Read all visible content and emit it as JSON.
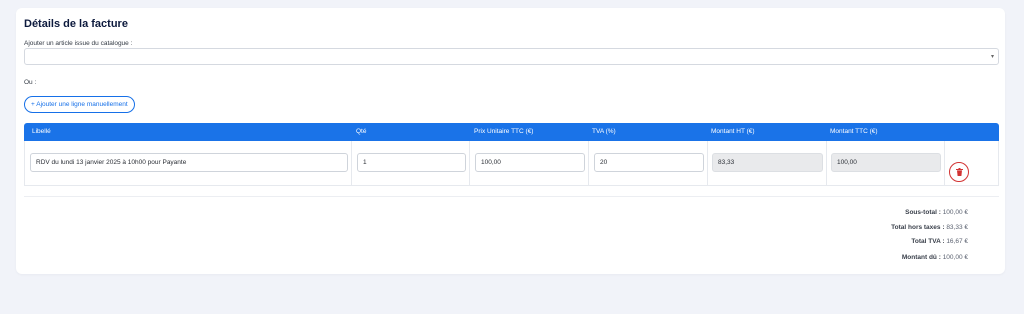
{
  "invoice": {
    "title": "Détails de la facture",
    "catalog_label": "Ajouter un article issue du catalogue :",
    "catalog_value": "",
    "or_label": "Ou :",
    "add_manual_label": "+ Ajouter une ligne manuellement"
  },
  "table": {
    "headers": {
      "libelle": "Libellé",
      "qte": "Qté",
      "prix_unitaire_ttc": "Prix Unitaire TTC (€)",
      "tva": "TVA (%)",
      "montant_ht": "Montant HT (€)",
      "montant_ttc": "Montant TTC (€)"
    },
    "rows": [
      {
        "libelle": "RDV du lundi 13 janvier 2025 à 10h00 pour Payante",
        "qte": "1",
        "prix_unitaire_ttc": "100,00",
        "tva": "20",
        "montant_ht": "83,33",
        "montant_ttc": "100,00"
      }
    ]
  },
  "totals": {
    "sous_total_label": "Sous-total :",
    "sous_total_value": "100,00 €",
    "total_ht_label": "Total hors taxes :",
    "total_ht_value": "83,33 €",
    "total_tva_label": "Total TVA :",
    "total_tva_value": "16,67 €",
    "montant_du_label": "Montant dû :",
    "montant_du_value": "100,00 €"
  },
  "icons": {
    "catalog_select": "chevron-down-icon",
    "delete": "trash-icon"
  },
  "colors": {
    "accent": "#1a73e8",
    "danger": "#d23333",
    "title": "#0d1a3d"
  }
}
